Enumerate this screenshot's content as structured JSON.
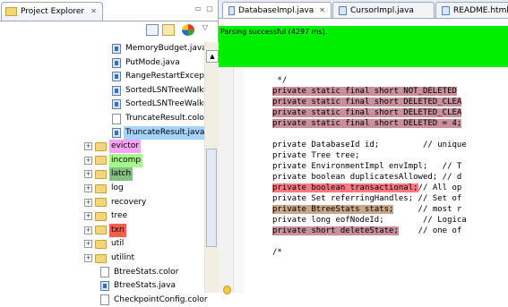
{
  "left_panel": {
    "tab_title": "Project Explorer",
    "tab_close": "✕",
    "minimize": "▭",
    "maximize": "▢",
    "tree": [
      {
        "label": "MemoryBudget.java",
        "kind": "java"
      },
      {
        "label": "PutMode.java",
        "kind": "java"
      },
      {
        "label": "RangeRestartExcepti",
        "kind": "java"
      },
      {
        "label": "SortedLSNTreeWalker",
        "kind": "java"
      },
      {
        "label": "SortedLSNTreeWalke",
        "kind": "java"
      },
      {
        "label": "TruncateResult.color",
        "kind": "file"
      },
      {
        "label": "TruncateResult.java",
        "kind": "java",
        "highlight": "#a7d3ff"
      },
      {
        "label": "evictor",
        "kind": "package",
        "expander": "+",
        "highlight": "#f8a4f3"
      },
      {
        "label": "incomp",
        "kind": "package",
        "expander": "+",
        "highlight": "#a6f78e"
      },
      {
        "label": "latch",
        "kind": "package",
        "expander": "+",
        "highlight": "#84c081"
      },
      {
        "label": "log",
        "kind": "package",
        "expander": "+"
      },
      {
        "label": "recovery",
        "kind": "package",
        "expander": "+"
      },
      {
        "label": "tree",
        "kind": "package",
        "expander": "+"
      },
      {
        "label": "txn",
        "kind": "package",
        "expander": "+",
        "highlight": "#f0604c"
      },
      {
        "label": "util",
        "kind": "package",
        "expander": "+"
      },
      {
        "label": "utilint",
        "kind": "package",
        "expander": "+"
      },
      {
        "label": "BtreeStats.color",
        "kind": "file"
      },
      {
        "label": "BtreeStats.java",
        "kind": "java"
      },
      {
        "label": "CheckpointConfig.color",
        "kind": "file"
      }
    ]
  },
  "editor": {
    "tabs": [
      {
        "label": "DatabaseImpl.java",
        "active": true,
        "close": "✕"
      },
      {
        "label": "CursorImpl.java"
      },
      {
        "label": "README.html"
      }
    ],
    "status_message": "Parsing successful (4297 ms).",
    "status_color": "#00f000",
    "code_lines": [
      {
        "text": " */",
        "hl": ""
      },
      {
        "text": "private static final short NOT_DELETED",
        "hl": "red"
      },
      {
        "text": "private static final short DELETED_CLEA",
        "hl": "red"
      },
      {
        "text": "private static final short DELETED_CLEA",
        "hl": "red"
      },
      {
        "text": "private static final short DELETED = 4;",
        "hl": "red"
      },
      {
        "text": "",
        "hl": ""
      },
      {
        "text": "private DatabaseId id;         // unique",
        "hl": ""
      },
      {
        "text": "private Tree tree;",
        "hl": ""
      },
      {
        "text": "private EnvironmentImpl envImpl;   // T",
        "hl": ""
      },
      {
        "text": "private boolean duplicatesAllowed; // d",
        "hl": ""
      },
      {
        "text": "private boolean transactional;",
        "tail": "// All op",
        "hl": "pink"
      },
      {
        "text": "private Set referringHandles; // Set of",
        "hl": ""
      },
      {
        "text": "private BtreeStats stats;",
        "tail": "     // most r",
        "hl": "brown"
      },
      {
        "text": "private long eofNodeId;        // Logica",
        "hl": ""
      },
      {
        "text": "private short deleteState;",
        "tail": "    // one of",
        "hl": "red"
      },
      {
        "text": "",
        "hl": ""
      },
      {
        "text": "/*",
        "hl": ""
      }
    ]
  }
}
